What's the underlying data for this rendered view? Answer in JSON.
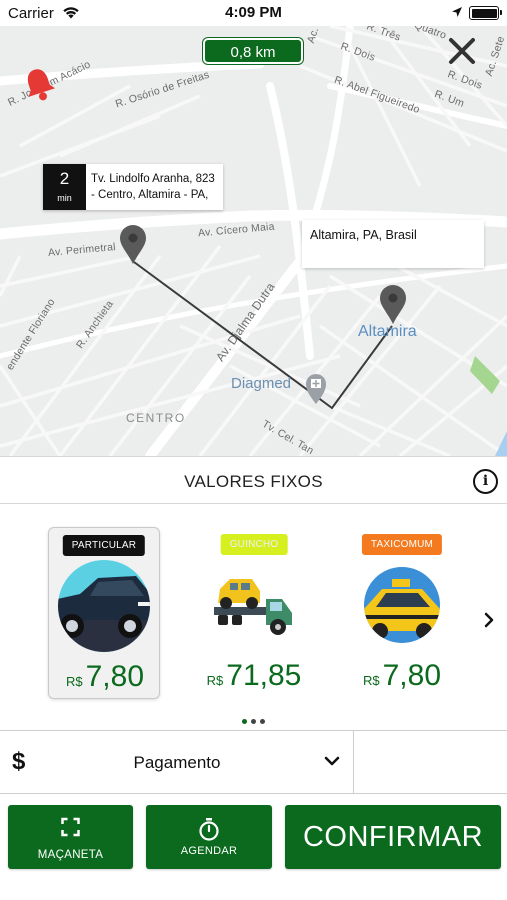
{
  "status_bar": {
    "carrier": "Carrier",
    "time": "4:09 PM"
  },
  "map": {
    "distance": "0,8 km",
    "eta": {
      "value": "2",
      "unit": "min",
      "address": "Tv. Lindolfo Aranha, 823 - Centro, Altamira - PA,"
    },
    "destination": "Altamira, PA, Brasil",
    "streets": [
      "R. Três",
      "R. Quatro",
      "R. Dois",
      "R. Dois",
      "R. Abel Figueiredo",
      "R. Um",
      "Ac. Olivio",
      "Ac. Sete",
      "R. Joaquim Acácio",
      "R. Osório de Freitas",
      "Av. Perimetral",
      "Av. Cícero Maia",
      "Av. Djalma Dutra",
      "R. Anchieta",
      "endente Floriano",
      "Tv. Cel. Tan"
    ],
    "places": {
      "city": "Altamira",
      "poi": "Diagmed",
      "district": "CENTRO"
    },
    "colors": {
      "route": "#3a3a3a",
      "bell": "#e53935",
      "pill": "#0b6a1e"
    }
  },
  "section": {
    "title": "VALORES FIXOS"
  },
  "vehicles": [
    {
      "badge": "PARTICULAR",
      "badge_color": "#111111",
      "currency": "R$",
      "price": "7,80",
      "icon": "car-icon",
      "selected": true
    },
    {
      "badge": "GUINCHO",
      "badge_color": "#d6ef1e",
      "currency": "R$",
      "price": "71,85",
      "icon": "tow-truck-icon",
      "selected": false
    },
    {
      "badge": "TAXICOMUM",
      "badge_color": "#f47a1f",
      "currency": "R$",
      "price": "7,80",
      "icon": "taxi-icon",
      "selected": false
    }
  ],
  "pagination": {
    "pages": 3,
    "current": 1
  },
  "payment": {
    "icon": "$",
    "label": "Pagamento"
  },
  "actions": {
    "macaneta": "MAÇANETA",
    "agendar": "AGENDAR",
    "confirmar": "CONFIRMAR"
  }
}
